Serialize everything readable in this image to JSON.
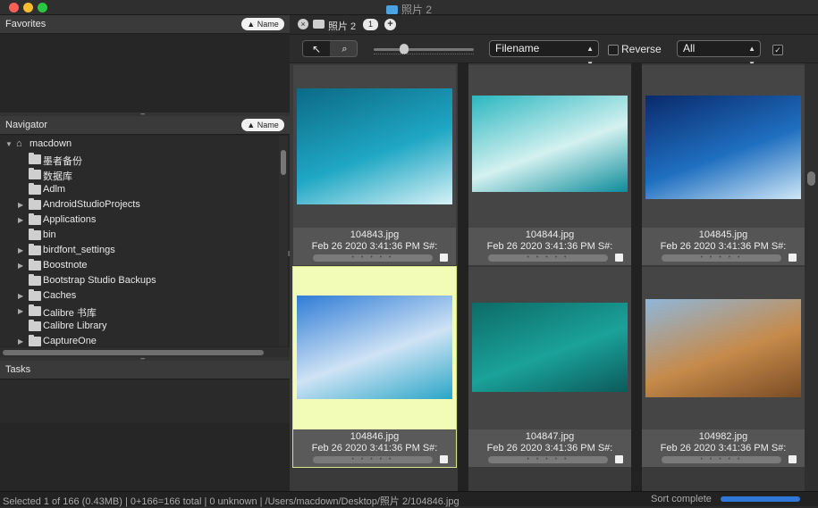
{
  "window": {
    "title": "照片 2"
  },
  "left": {
    "favorites": {
      "title": "Favorites",
      "sort_label": "▲ Name"
    },
    "navigator": {
      "title": "Navigator",
      "sort_label": "▲ Name",
      "root": "macdown",
      "items": [
        {
          "label": "墨者备份",
          "expandable": false
        },
        {
          "label": "数据库",
          "expandable": false
        },
        {
          "label": "Adlm",
          "expandable": false
        },
        {
          "label": "AndroidStudioProjects",
          "expandable": true
        },
        {
          "label": "Applications",
          "expandable": true
        },
        {
          "label": "bin",
          "expandable": false
        },
        {
          "label": "birdfont_settings",
          "expandable": true
        },
        {
          "label": "Boostnote",
          "expandable": true
        },
        {
          "label": "Bootstrap Studio Backups",
          "expandable": false
        },
        {
          "label": "Caches",
          "expandable": true
        },
        {
          "label": "Calibre 书库",
          "expandable": true
        },
        {
          "label": "Calibre Library",
          "expandable": false
        },
        {
          "label": "CaptureOne",
          "expandable": true
        }
      ]
    },
    "tasks": {
      "title": "Tasks"
    }
  },
  "tab": {
    "label": "照片 2",
    "count": "1",
    "close": "×",
    "add": "+"
  },
  "toolbar": {
    "select_tool": "↖",
    "zoom_tool": "⌕",
    "sort_field": "Filename",
    "reverse_label": "Reverse",
    "reverse_checked": false,
    "filter": "All",
    "option_checked": true,
    "thumb_size_level": 0.28
  },
  "thumbnails": [
    {
      "name": "104843.jpg",
      "date": "Feb 26 2020 3:41:36 PM S#:",
      "selected": false,
      "colors": [
        "#0b6a86",
        "#1fa7c4",
        "#d8f2f6"
      ]
    },
    {
      "name": "104844.jpg",
      "date": "Feb 26 2020 3:41:36 PM S#:",
      "selected": false,
      "colors": [
        "#2bb7c0",
        "#d4f1f0",
        "#0d8c9a"
      ]
    },
    {
      "name": "104845.jpg",
      "date": "Feb 26 2020 3:41:36 PM S#:",
      "selected": false,
      "colors": [
        "#0a2a6b",
        "#1f6fc0",
        "#cfe7f7"
      ]
    },
    {
      "name": "104846.jpg",
      "date": "Feb 26 2020 3:41:36 PM S#:",
      "selected": true,
      "colors": [
        "#2f7cd6",
        "#cfe3f5",
        "#2aa6c6"
      ]
    },
    {
      "name": "104847.jpg",
      "date": "Feb 26 2020 3:41:36 PM S#:",
      "selected": false,
      "colors": [
        "#0e6b66",
        "#1aa29a",
        "#0c5a5a"
      ]
    },
    {
      "name": "104982.jpg",
      "date": "Feb 26 2020 3:41:36 PM S#:",
      "selected": false,
      "colors": [
        "#8fb6d9",
        "#c68a4a",
        "#7a4c25"
      ]
    }
  ],
  "rating_dots": "• • • • •",
  "status": {
    "text": "Selected 1 of 166 (0.43MB) | 0+166=166 total | 0 unknown | /Users/macdown/Desktop/照片 2/104846.jpg",
    "sort_state": "Sort complete",
    "progress": 1.0
  },
  "colors": {
    "accent": "#2f78d7",
    "selection": "#f2fcb6"
  }
}
